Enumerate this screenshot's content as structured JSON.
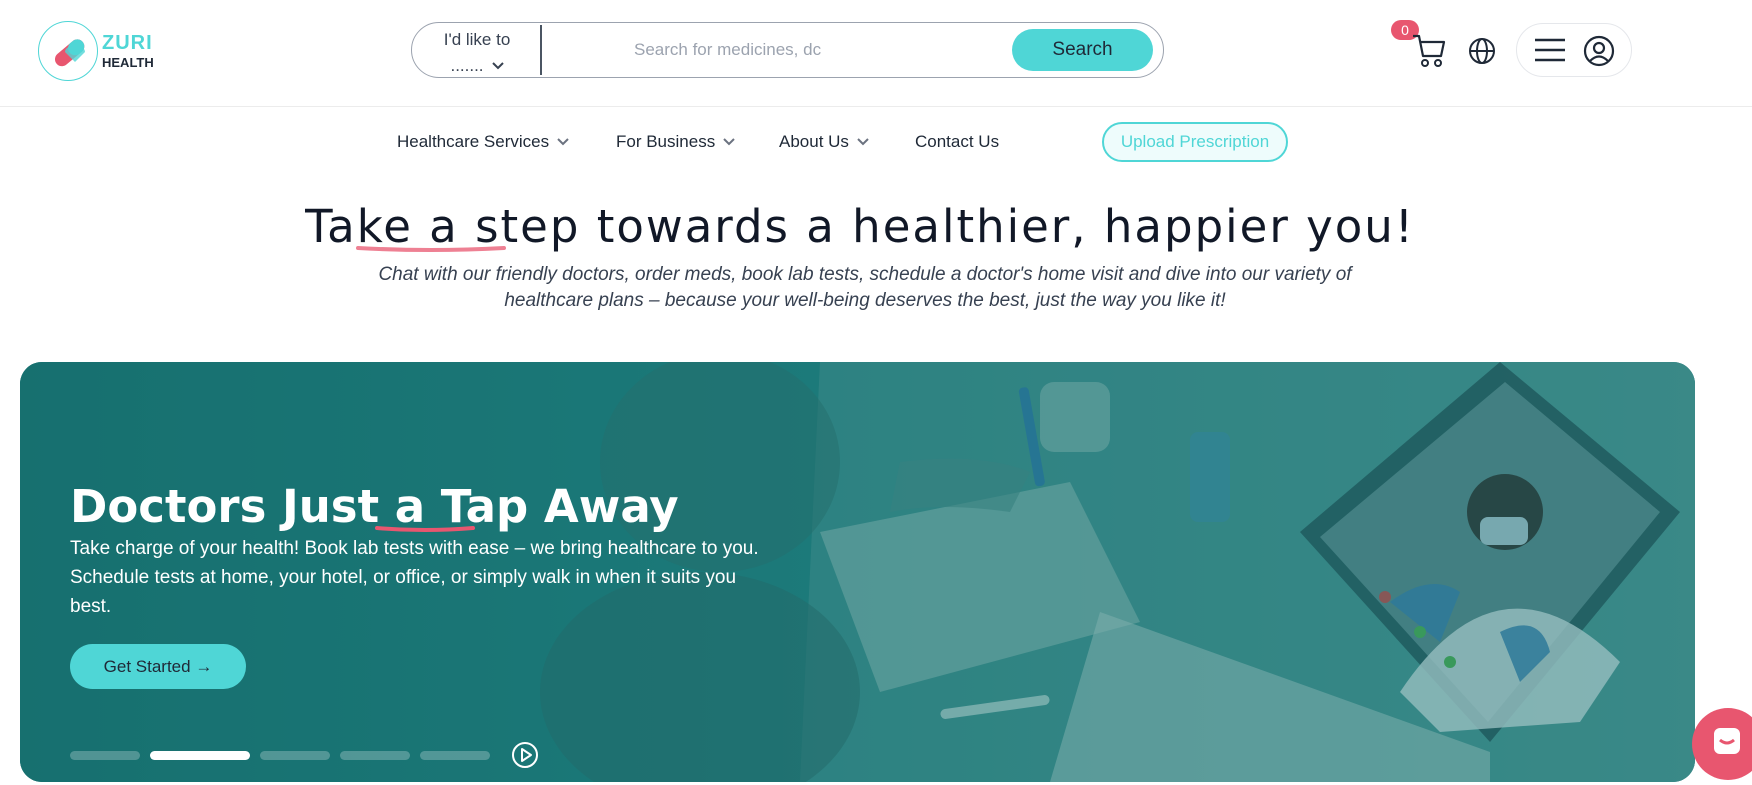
{
  "brand": {
    "name_line1": "ZURI",
    "name_line2": "HEALTH"
  },
  "search": {
    "intent_label_line1": "I'd like to",
    "intent_label_line2": ".......",
    "placeholder": "Search for medicines, dc",
    "button_label": "Search"
  },
  "header": {
    "cart_count": "0"
  },
  "nav": {
    "items": [
      {
        "label": "Healthcare Services"
      },
      {
        "label": "For Business"
      },
      {
        "label": "About Us"
      },
      {
        "label": "Contact Us"
      }
    ],
    "upload_label": "Upload Prescription"
  },
  "hero": {
    "title": "Take a step towards a healthier, happier you!",
    "subtitle": "Chat with our friendly doctors, order meds, book lab tests, schedule a doctor's home visit and dive into our variety of healthcare plans – because your well-being deserves the best, just the way you like it!"
  },
  "banner": {
    "title": "Doctors Just a Tap Away",
    "text": "Take charge of your health! Book lab tests with ease – we bring healthcare to you. Schedule tests at home, your hotel, or office, or simply walk in when it suits you best.",
    "cta_label": "Get Started →",
    "slide_count": 5,
    "active_slide": 2
  },
  "colors": {
    "accent": "#4fd6d6",
    "brand_pink": "#e8566f",
    "banner_teal": "#1c7b7b"
  }
}
